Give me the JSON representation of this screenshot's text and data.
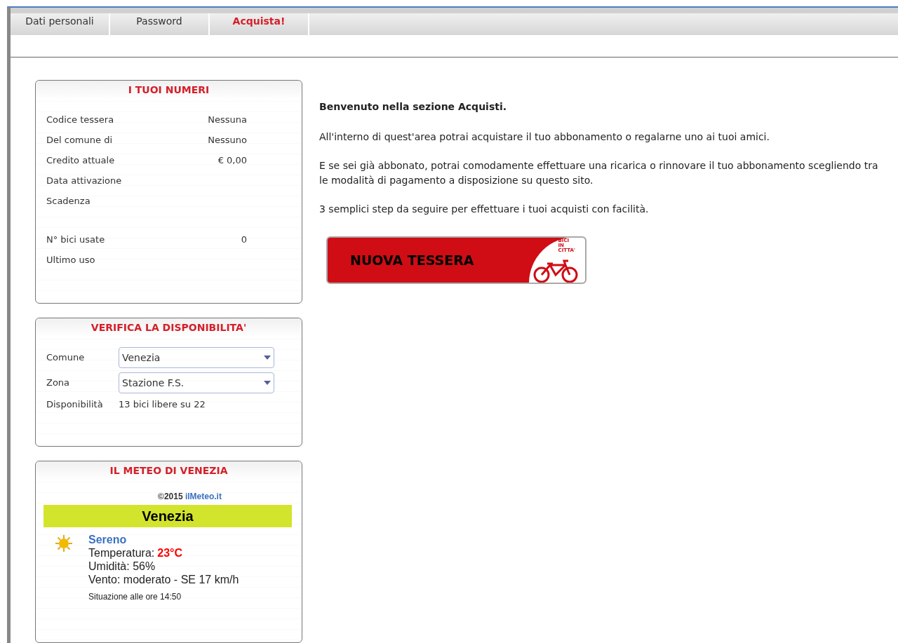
{
  "tabs": [
    {
      "label": "Dati personali",
      "selected": false
    },
    {
      "label": "Password",
      "selected": false
    },
    {
      "label": "Acquista!",
      "selected": true
    }
  ],
  "numbers_panel": {
    "title": "I TUOI NUMERI",
    "row_groups": [
      [
        {
          "label": "Codice tessera",
          "value": "Nessuna"
        },
        {
          "label": "Del comune di",
          "value": "Nessuno"
        },
        {
          "label": "Credito attuale",
          "value": "€ 0,00"
        },
        {
          "label": "Data attivazione"
        },
        {
          "label": "Scadenza"
        }
      ],
      [
        {
          "label": "N° bici usate",
          "value": "0"
        },
        {
          "label": "Ultimo uso"
        }
      ]
    ]
  },
  "availability_panel": {
    "title": "VERIFICA LA DISPONIBILITA'",
    "fields": [
      {
        "label": "Comune",
        "value": "Venezia"
      },
      {
        "label": "Zona",
        "value": "Stazione F.S."
      }
    ],
    "result_label": "Disponibilità",
    "result": "13 bici libere su 22"
  },
  "weather_panel": {
    "title": "IL METEO DI VENEZIA",
    "copyright": "©2015",
    "source_link": "ilMeteo.it",
    "city": "Venezia",
    "condition": "Sereno",
    "temperature_label": "Temperatura:",
    "temperature": "23°C",
    "humidity": "Umidità: 56%",
    "wind": "Vento: moderato - SE 17 km/h",
    "updated": "Situazione alle ore 14:50"
  },
  "intro": {
    "heading": "Benvenuto nella sezione Acquisti.",
    "paragraphs": [
      "All'interno di quest'area potrai acquistare il tuo abbonamento o regalarne uno ai tuoi amici.",
      "E se sei già abbonato, potrai comodamente effettuare una ricarica o rinnovare il tuo abbonamento scegliendo tra le modalità di pagamento a disposizione su questo sito.",
      "3 semplici step da seguire per effettuare i tuoi acquisti con facilità."
    ]
  },
  "new_card_button": {
    "label": "NUOVA TESSERA",
    "logo_lines": [
      "BICI",
      "IN",
      "CITTA'"
    ]
  }
}
